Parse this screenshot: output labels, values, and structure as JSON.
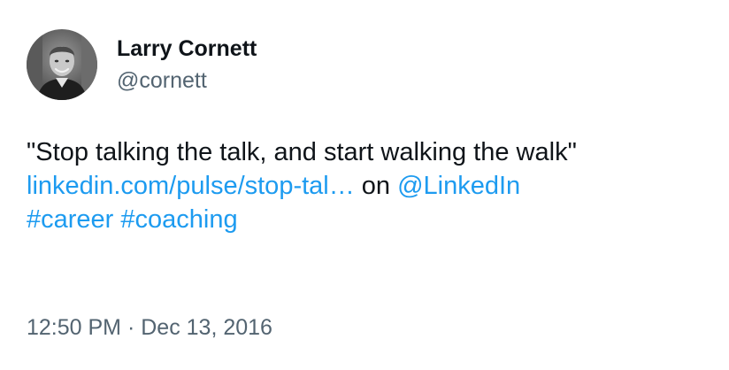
{
  "author": {
    "display_name": "Larry Cornett",
    "handle": "@cornett",
    "avatar_icon": "user-avatar-photo"
  },
  "tweet": {
    "quote_text": "\"Stop talking the talk, and start walking the walk\"",
    "link_text": "linkedin.com/pulse/stop-tal…",
    "connector_text": " on ",
    "mention_text": "@LinkedIn",
    "hashtag_1": "#career",
    "hashtag_separator": " ",
    "hashtag_2": "#coaching"
  },
  "meta": {
    "time": "12:50 PM",
    "separator": " · ",
    "date": "Dec 13, 2016"
  },
  "colors": {
    "link": "#1d9bf0",
    "text": "#0f1419",
    "secondary": "#536471"
  }
}
